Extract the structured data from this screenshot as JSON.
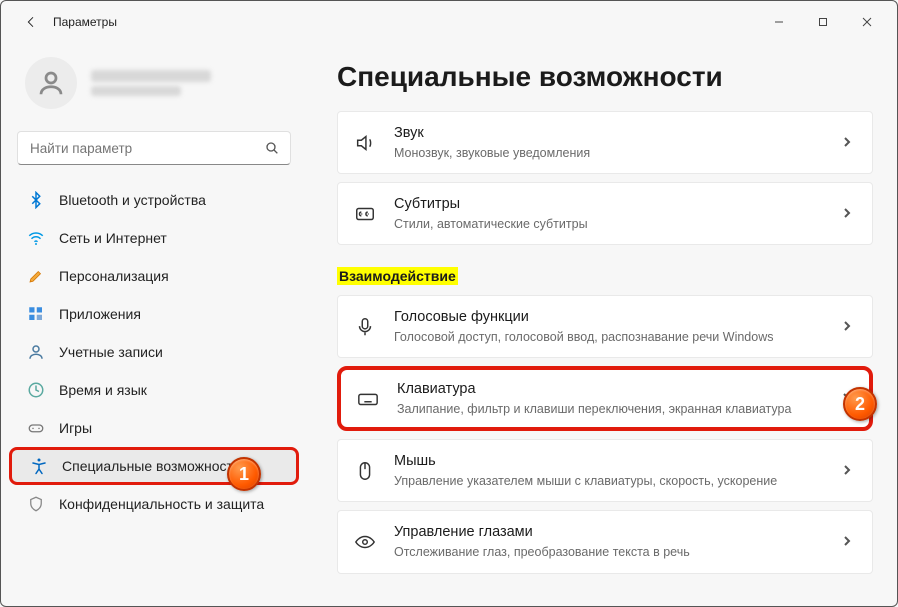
{
  "titlebar": {
    "title": "Параметры"
  },
  "search": {
    "placeholder": "Найти параметр"
  },
  "nav": {
    "items": [
      {
        "label": "Bluetooth и устройства"
      },
      {
        "label": "Сеть и Интернет"
      },
      {
        "label": "Персонализация"
      },
      {
        "label": "Приложения"
      },
      {
        "label": "Учетные записи"
      },
      {
        "label": "Время и язык"
      },
      {
        "label": "Игры"
      },
      {
        "label": "Специальные возможности"
      },
      {
        "label": "Конфиденциальность и защита"
      }
    ]
  },
  "page": {
    "title": "Специальные возможности",
    "section_interaction": "Взаимодействие",
    "cards": {
      "sound": {
        "title": "Звук",
        "sub": "Монозвук, звуковые уведомления"
      },
      "captions": {
        "title": "Субтитры",
        "sub": "Стили, автоматические субтитры"
      },
      "voice": {
        "title": "Голосовые функции",
        "sub": "Голосовой доступ, голосовой ввод, распознавание речи Windows"
      },
      "keyboard": {
        "title": "Клавиатура",
        "sub": "Залипание, фильтр и клавиши переключения, экранная клавиатура"
      },
      "mouse": {
        "title": "Мышь",
        "sub": "Управление указателем мыши с клавиатуры, скорость, ускорение"
      },
      "eye": {
        "title": "Управление глазами",
        "sub": "Отслеживание глаз, преобразование текста в речь"
      }
    }
  },
  "callouts": {
    "one": "1",
    "two": "2"
  }
}
